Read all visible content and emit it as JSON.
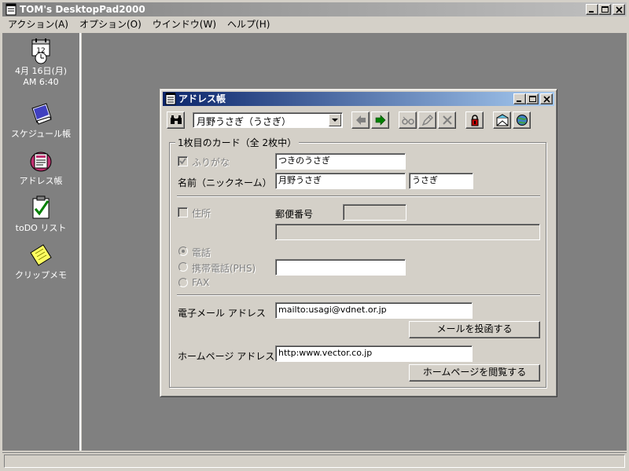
{
  "app": {
    "title": "TOM's DesktopPad2000"
  },
  "menu": [
    "アクション(A)",
    "オプション(O)",
    "ウインドウ(W)",
    "ヘルプ(H)"
  ],
  "sidebar": {
    "clock_date": "4月 16日(月)",
    "clock_time": "AM 6:40",
    "items": [
      {
        "label": "スケジュール帳",
        "icon": "schedule-book-icon"
      },
      {
        "label": "アドレス帳",
        "icon": "address-book-icon"
      },
      {
        "label": "toDO リスト",
        "icon": "todo-list-icon"
      },
      {
        "label": "クリップメモ",
        "icon": "clip-memo-icon"
      }
    ]
  },
  "address_book": {
    "title": "アドレス帳",
    "selected_entry": "月野うさぎ（うさぎ）",
    "card_counter": "1枚目のカード（全 2枚中）",
    "furigana_label": "ふりがな",
    "furigana_value": "つきのうさぎ",
    "name_label": "名前（ニックネーム）",
    "name_value": "月野うさぎ",
    "nickname_value": "うさぎ",
    "address_label": "住所",
    "postal_label": "郵便番号",
    "postal_value": "",
    "address_value": "",
    "phone_options": [
      "電話",
      "携帯電話(PHS)",
      "FAX"
    ],
    "phone_value": "",
    "email_label": "電子メール アドレス",
    "email_value": "mailto:usagi@vdnet.or.jp",
    "send_mail_button": "メールを投函する",
    "homepage_label": "ホームページ アドレス",
    "homepage_value": "http:www.vector.co.jp",
    "browse_button": "ホームページを閲覧する"
  },
  "colors": {
    "face": "#d4d0c8",
    "desktop": "#808080",
    "title_active": "#0a246a",
    "title_gradient_end": "#a6caf0"
  }
}
